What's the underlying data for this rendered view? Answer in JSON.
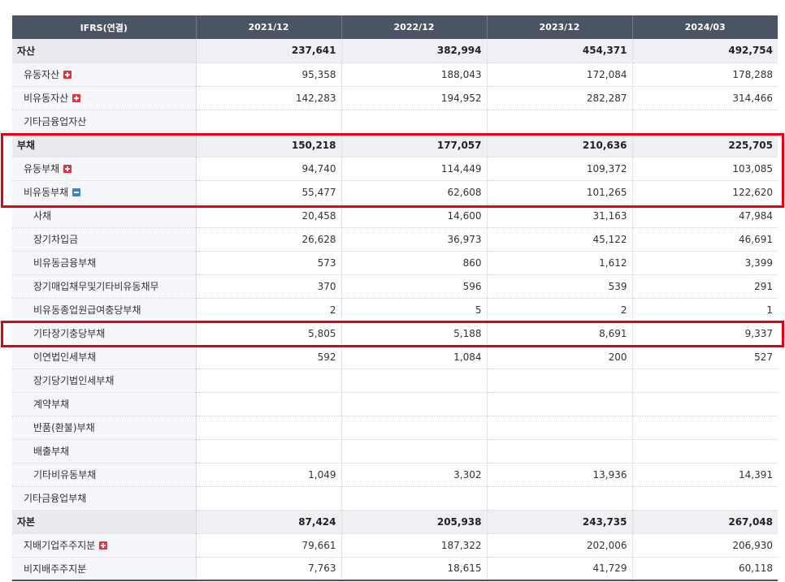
{
  "header": [
    "IFRS(연결)",
    "2021/12",
    "2022/12",
    "2023/12",
    "2024/03"
  ],
  "rows": [
    {
      "label": "자산",
      "level": 0,
      "values": [
        "237,641",
        "382,994",
        "454,371",
        "492,754"
      ]
    },
    {
      "label": "유동자산",
      "level": 1,
      "toggle": "plus",
      "toggle_icon": "expand-plus-icon",
      "values": [
        "95,358",
        "188,043",
        "172,084",
        "178,288"
      ]
    },
    {
      "label": "비유동자산",
      "level": 1,
      "toggle": "plus",
      "toggle_icon": "expand-plus-icon",
      "values": [
        "142,283",
        "194,952",
        "282,287",
        "314,466"
      ]
    },
    {
      "label": "기타금융업자산",
      "level": 1,
      "values": [
        "",
        "",
        "",
        ""
      ]
    },
    {
      "label": "부채",
      "level": 0,
      "values": [
        "150,218",
        "177,057",
        "210,636",
        "225,705"
      ]
    },
    {
      "label": "유동부채",
      "level": 1,
      "toggle": "plus",
      "toggle_icon": "expand-plus-icon",
      "values": [
        "94,740",
        "114,449",
        "109,372",
        "103,085"
      ]
    },
    {
      "label": "비유동부채",
      "level": 1,
      "toggle": "minus",
      "toggle_icon": "collapse-minus-icon",
      "values": [
        "55,477",
        "62,608",
        "101,265",
        "122,620"
      ]
    },
    {
      "label": "사채",
      "level": 2,
      "values": [
        "20,458",
        "14,600",
        "31,163",
        "47,984"
      ]
    },
    {
      "label": "장기차입금",
      "level": 2,
      "values": [
        "26,628",
        "36,973",
        "45,122",
        "46,691"
      ]
    },
    {
      "label": "비유동금융부채",
      "level": 2,
      "values": [
        "573",
        "860",
        "1,612",
        "3,399"
      ]
    },
    {
      "label": "장기매입채무및기타비유동채무",
      "level": 2,
      "values": [
        "370",
        "596",
        "539",
        "291"
      ]
    },
    {
      "label": "비유동종업원급여충당부채",
      "level": 2,
      "values": [
        "2",
        "5",
        "2",
        "1"
      ]
    },
    {
      "label": "기타장기충당부채",
      "level": 2,
      "values": [
        "5,805",
        "5,188",
        "8,691",
        "9,337"
      ]
    },
    {
      "label": "이연법인세부채",
      "level": 2,
      "values": [
        "592",
        "1,084",
        "200",
        "527"
      ]
    },
    {
      "label": "장기당기법인세부채",
      "level": 2,
      "values": [
        "",
        "",
        "",
        ""
      ]
    },
    {
      "label": "계약부채",
      "level": 2,
      "values": [
        "",
        "",
        "",
        ""
      ]
    },
    {
      "label": "반품(환불)부채",
      "level": 2,
      "values": [
        "",
        "",
        "",
        ""
      ]
    },
    {
      "label": "배출부채",
      "level": 2,
      "values": [
        "",
        "",
        "",
        ""
      ]
    },
    {
      "label": "기타비유동부채",
      "level": 2,
      "values": [
        "1,049",
        "3,302",
        "13,936",
        "14,391"
      ]
    },
    {
      "label": "기타금융업부채",
      "level": 1,
      "values": [
        "",
        "",
        "",
        ""
      ]
    },
    {
      "label": "자본",
      "level": 0,
      "values": [
        "87,424",
        "205,938",
        "243,735",
        "267,048"
      ]
    },
    {
      "label": "지배기업주주지분",
      "level": 1,
      "toggle": "plus",
      "toggle_icon": "expand-plus-icon",
      "values": [
        "79,661",
        "187,322",
        "202,006",
        "206,930"
      ]
    },
    {
      "label": "비지배주주지분",
      "level": 1,
      "values": [
        "7,763",
        "18,615",
        "41,729",
        "60,118"
      ]
    }
  ],
  "highlight_color": "#e60012",
  "header_color": "#4a5463"
}
